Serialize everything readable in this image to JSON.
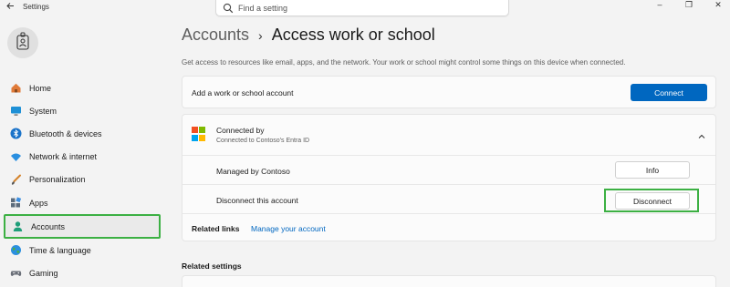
{
  "window": {
    "title": "Settings",
    "controls": [
      "–",
      "❐",
      "✕"
    ]
  },
  "search": {
    "placeholder": "Find a setting"
  },
  "sidebar": {
    "items": [
      {
        "label": "Home",
        "icon": "home-icon"
      },
      {
        "label": "System",
        "icon": "system-icon"
      },
      {
        "label": "Bluetooth & devices",
        "icon": "bluetooth-icon"
      },
      {
        "label": "Network & internet",
        "icon": "wifi-icon"
      },
      {
        "label": "Personalization",
        "icon": "brush-icon"
      },
      {
        "label": "Apps",
        "icon": "apps-icon"
      },
      {
        "label": "Accounts",
        "icon": "person-icon",
        "selected": true
      },
      {
        "label": "Time & language",
        "icon": "globe-icon"
      },
      {
        "label": "Gaming",
        "icon": "gamepad-icon"
      }
    ]
  },
  "breadcrumb": {
    "parent": "Accounts",
    "separator": "›",
    "current": "Access work or school"
  },
  "description": "Get access to resources like email, apps, and the network. Your work or school might control some things on this device when connected.",
  "add_account": {
    "label": "Add a work or school account",
    "button": "Connect"
  },
  "connection": {
    "title": "Connected by",
    "subtitle": "Connected to Contoso's Entra ID",
    "managed_label": "Managed by Contoso",
    "info_button": "Info",
    "disconnect_label": "Disconnect this account",
    "disconnect_button": "Disconnect",
    "related_links_label": "Related links",
    "manage_link": "Manage your account"
  },
  "related_settings": {
    "title": "Related settings"
  },
  "colors": {
    "accent": "#0067c0",
    "highlight": "#3cb043"
  }
}
